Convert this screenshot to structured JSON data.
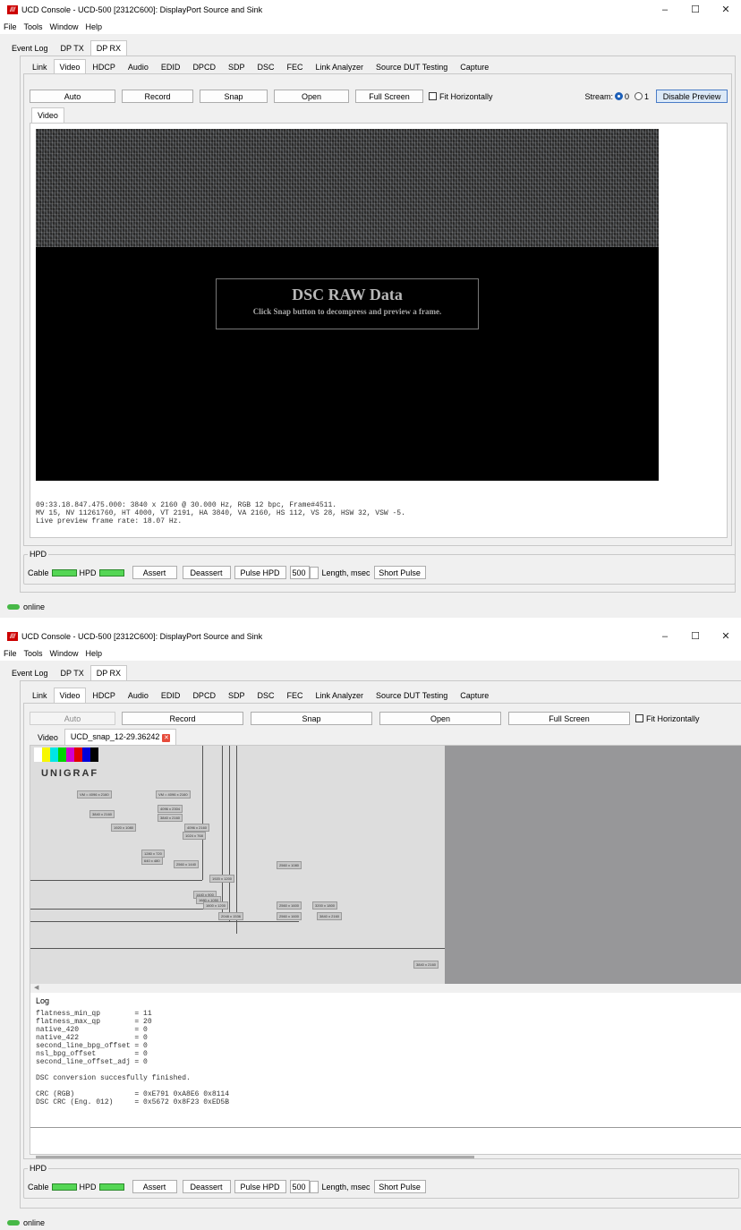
{
  "win1": {
    "title": "UCD Console - UCD-500 [2312C600]: DisplayPort Source and Sink",
    "menu": [
      "File",
      "Tools",
      "Window",
      "Help"
    ],
    "main_tabs": [
      "Event Log",
      "DP TX",
      "DP RX"
    ],
    "sub_tabs": [
      "Link",
      "Video",
      "HDCP",
      "Audio",
      "EDID",
      "DPCD",
      "SDP",
      "DSC",
      "FEC",
      "Link Analyzer",
      "Source DUT Testing",
      "Capture"
    ],
    "buttons": {
      "auto": "Auto",
      "record": "Record",
      "snap": "Snap",
      "open": "Open",
      "full_screen": "Full Screen",
      "fit_horizontally": "Fit Horizontally",
      "disable_preview": "Disable Preview"
    },
    "stream": {
      "label": "Stream:",
      "opt0": "0",
      "opt1": "1"
    },
    "inner_tab": "Video",
    "dsc_title": "DSC RAW Data",
    "dsc_sub": "Click Snap button to decompress and preview a frame.",
    "info_lines": "09:33.18.847.475.000: 3840 x 2160 @ 30.000 Hz, RGB 12 bpc, Frame#4511.\nMV 15, NV 11261760, HT 4000, VT 2191, HA 3840, VA 2160, HS 112, VS 28, HSW 32, VSW -5.\nLive preview frame rate: 18.07 Hz.",
    "hpd": {
      "group": "HPD",
      "cable": "Cable",
      "hpd": "HPD",
      "assert": "Assert",
      "deassert": "Deassert",
      "pulse": "Pulse HPD",
      "length_value": "500",
      "length_label": "Length, msec",
      "short_pulse": "Short Pulse"
    },
    "status": "online"
  },
  "win2": {
    "title": "UCD Console - UCD-500 [2312C600]: DisplayPort Source and Sink",
    "inner_tabs": [
      "Video",
      "UCD_snap_12-29.36242"
    ],
    "logo_text": "UNIGRAF",
    "log_label": "Log",
    "log_lines": "flatness_min_qp        = 11\nflatness_max_qp        = 20\nnative_420             = 0\nnative_422             = 0\nsecond_line_bpg_offset = 0\nnsl_bpg_offset         = 0\nsecond_line_offset_adj = 0\n\nDSC conversion succesfully finished.\n\nCRC (RGB)              = 0xE791 0xA8E6 0x8114\nDSC CRC (Eng. 012)     = 0x5672 0x8F23 0xED5B",
    "status": "online",
    "chips": [
      "VM = 4096 x 2160",
      "VM = 4096 x 2160",
      "4096 x 2304",
      "3840 x 2160",
      "1920 x 1080",
      "3840 x 2160",
      "4096 x 2160",
      "1024 x 768",
      "1280 x 720",
      "640 x 480",
      "2560 x 1080",
      "2560 x 1440",
      "1920 x 1200",
      "1440 x 900",
      "2560 x 1600",
      "1680 x 1050",
      "1600 x 1200",
      "2048 x 1536",
      "3200 x 1800",
      "3840 x 2160",
      "2560 x 1600",
      "3840 x 2160"
    ],
    "colorbars": [
      "#ffffff",
      "#f7f700",
      "#00e6e6",
      "#00d400",
      "#d000d0",
      "#e00000",
      "#0000d8",
      "#000000"
    ]
  }
}
